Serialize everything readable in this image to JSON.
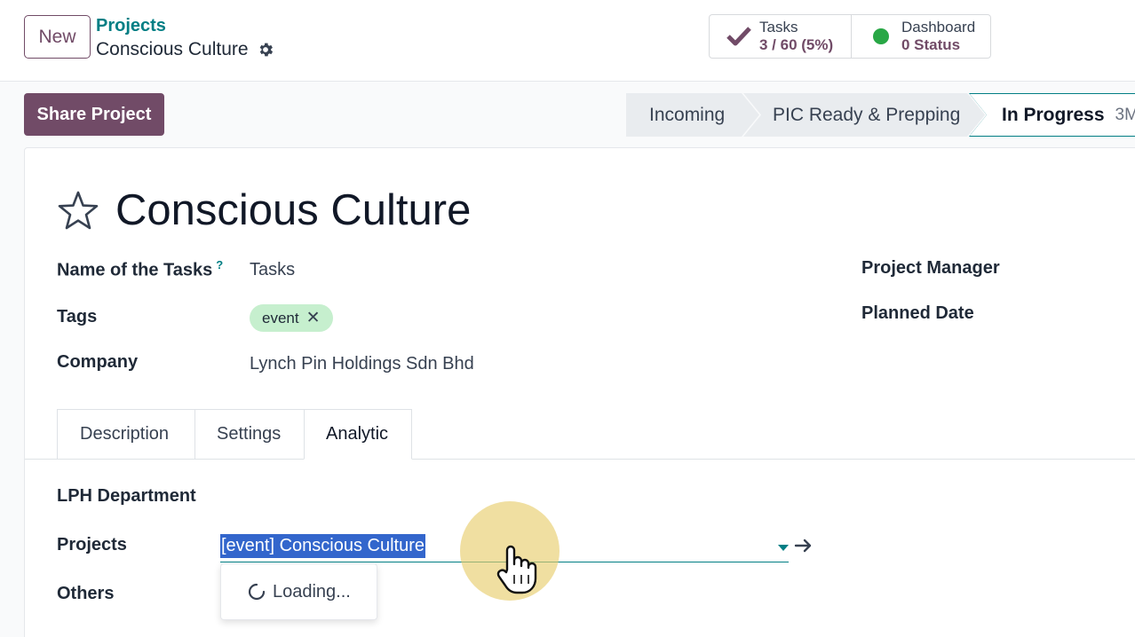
{
  "topbar": {
    "new_label": "New",
    "breadcrumb_parent": "Projects",
    "breadcrumb_current": "Conscious Culture",
    "tasks": {
      "label": "Tasks",
      "value": "3 / 60 (5%)"
    },
    "dashboard": {
      "label": "Dashboard",
      "value": "0 Status"
    }
  },
  "actions": {
    "share_label": "Share Project"
  },
  "stages": [
    {
      "label": "Incoming"
    },
    {
      "label": "PIC Ready & Prepping"
    },
    {
      "label": "In Progress",
      "duration": "3M"
    }
  ],
  "form": {
    "title": "Conscious Culture",
    "fields": {
      "tasks_name_label": "Name of the Tasks",
      "tasks_name_help": "?",
      "tasks_name_value": "Tasks",
      "tags_label": "Tags",
      "tag_value": "event",
      "company_label": "Company",
      "company_value": "Lynch Pin Holdings Sdn Bhd",
      "manager_label": "Project Manager",
      "planned_label": "Planned Date"
    },
    "tabs": [
      "Description",
      "Settings",
      "Analytic"
    ],
    "analytic": {
      "department_label": "LPH Department",
      "projects_label": "Projects",
      "projects_value": "[event] Conscious Culture",
      "others_label": "Others",
      "loading_text": "Loading..."
    }
  },
  "colors": {
    "brand": "#714b67",
    "accent": "#017e84",
    "tag_bg": "#c6efce",
    "status_green": "#28a745",
    "selection": "#3366cc"
  },
  "icons": [
    "gear-icon",
    "checkmark-icon",
    "status-dot-icon",
    "star-icon",
    "tag-remove-icon",
    "dropdown-caret-icon",
    "internal-link-arrow-icon",
    "spinner-icon",
    "hand-cursor-icon"
  ]
}
